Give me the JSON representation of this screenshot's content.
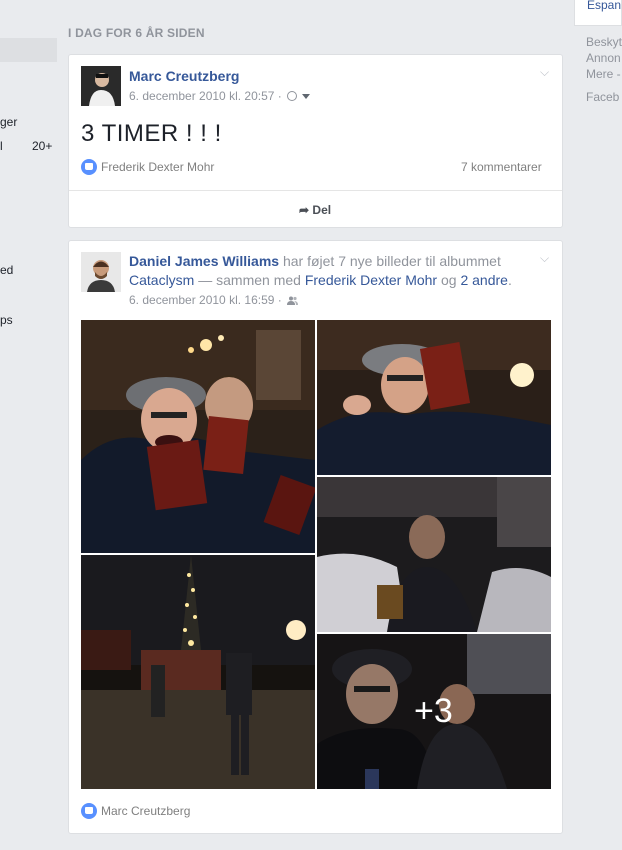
{
  "left_nav": {
    "items": [
      {
        "label": "ger"
      },
      {
        "label": "l",
        "count": "20+"
      },
      {
        "label": "ed"
      },
      {
        "label": "ps"
      }
    ]
  },
  "right_rail": {
    "language_label": "Espan",
    "footer_lines": [
      "Beskyt",
      "Annon",
      "Mere -",
      "Faceb"
    ]
  },
  "section_title": "I DAG FOR 6 ÅR SIDEN",
  "post1": {
    "author": "Marc Creutzberg",
    "timestamp": "6. december 2010 kl. 20:57 ·",
    "privacy_icon": "globe-icon",
    "text": "3 TIMER ! ! !",
    "reaction_name": "Frederik Dexter Mohr",
    "comments": "7 kommentarer",
    "share_label": "Del"
  },
  "post2": {
    "author": "Daniel James Williams",
    "action_text": " har føjet 7 nye billeder til albummet ",
    "album": "Cataclysm",
    "with_text": " — sammen med ",
    "tagged": "Frederik Dexter Mohr",
    "and_text": " og ",
    "others": "2 andre",
    "period": ".",
    "timestamp": "6. december 2010 kl. 16:59 ·",
    "privacy_icon": "friends-icon",
    "more_photos": "+3",
    "reaction_name": "Marc Creutzberg"
  },
  "colors": {
    "link": "#365899",
    "like": "#5890ff",
    "page_bg": "#e9ebee"
  }
}
